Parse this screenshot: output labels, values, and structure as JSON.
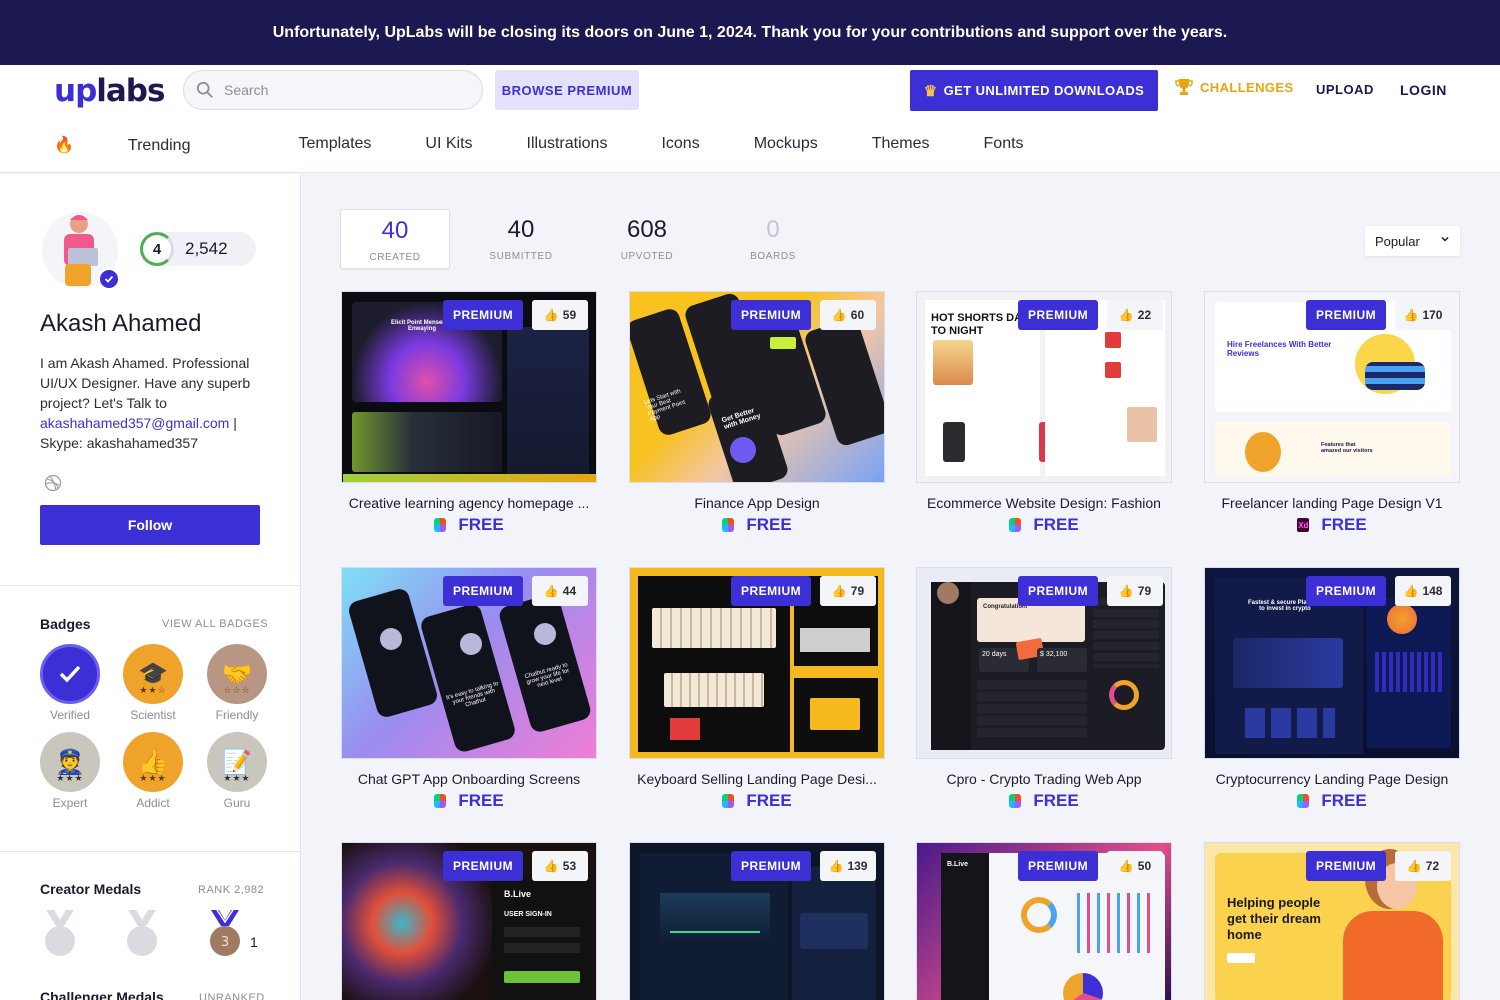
{
  "banner": {
    "text": "Unfortunately, UpLabs will be closing its doors on June 1, 2024. Thank you for your contributions and support over the years."
  },
  "header": {
    "logo_up": "up",
    "logo_labs": "labs",
    "search_placeholder": "Search",
    "browse_premium": "BROWSE PREMIUM",
    "unlimited": "GET UNLIMITED DOWNLOADS",
    "challenges": "CHALLENGES",
    "upload": "UPLOAD",
    "login": "LOGIN",
    "accent": "#3d2fd6"
  },
  "nav": {
    "items": [
      "Trending",
      "Templates",
      "UI Kits",
      "Illustrations",
      "Icons",
      "Mockups",
      "Themes",
      "Fonts"
    ]
  },
  "profile": {
    "level": "4",
    "points": "2,542",
    "name": "Akash Ahamed",
    "bio_1": "I am Akash Ahamed. Professional UI/UX Designer. Have any superb project? Let's Talk to ",
    "email": "akashahamed357@gmail.com",
    "bio_2": " | Skype: akashahamed357",
    "follow": "Follow"
  },
  "badges": {
    "title": "Badges",
    "view_all": "VIEW ALL BADGES",
    "items": [
      {
        "label": "Verified",
        "icon": "check-icon",
        "color": "#3d2fd6"
      },
      {
        "label": "Scientist",
        "icon": "graduation-cap-icon",
        "color": "#f0a32a"
      },
      {
        "label": "Friendly",
        "icon": "handshake-icon",
        "color": "#b99683"
      },
      {
        "label": "Expert",
        "icon": "officer-icon",
        "color": "#c9c7bd"
      },
      {
        "label": "Addict",
        "icon": "thumbs-up-icon",
        "color": "#f0a32a"
      },
      {
        "label": "Guru",
        "icon": "notepad-icon",
        "color": "#c9c7bd"
      }
    ]
  },
  "medals": {
    "title": "Creator Medals",
    "rank": "RANK 2,982",
    "bronze_count": "1",
    "bronze_number": "3"
  },
  "challenger": {
    "title": "Challenger Medals",
    "status": "UNRANKED"
  },
  "stats": [
    {
      "num": "40",
      "label": "CREATED"
    },
    {
      "num": "40",
      "label": "SUBMITTED"
    },
    {
      "num": "608",
      "label": "UPVOTED"
    },
    {
      "num": "0",
      "label": "BOARDS"
    }
  ],
  "sort": {
    "value": "Popular"
  },
  "cards": [
    {
      "title": "Creative learning agency homepage ...",
      "likes": "59",
      "price": "FREE",
      "tool": "figma",
      "premium": "PREMIUM"
    },
    {
      "title": "Finance App Design",
      "likes": "60",
      "price": "FREE",
      "tool": "figma",
      "premium": "PREMIUM"
    },
    {
      "title": "Ecommerce Website Design: Fashion",
      "likes": "22",
      "price": "FREE",
      "tool": "figma",
      "premium": "PREMIUM"
    },
    {
      "title": "Freelancer landing Page Design V1",
      "likes": "170",
      "price": "FREE",
      "tool": "xd",
      "premium": "PREMIUM"
    },
    {
      "title": "Chat GPT App Onboarding Screens",
      "likes": "44",
      "price": "FREE",
      "tool": "figma",
      "premium": "PREMIUM"
    },
    {
      "title": "Keyboard Selling Landing Page Desi...",
      "likes": "79",
      "price": "FREE",
      "tool": "figma",
      "premium": "PREMIUM"
    },
    {
      "title": "Cpro - Crypto Trading Web App",
      "likes": "79",
      "price": "FREE",
      "tool": "figma",
      "premium": "PREMIUM"
    },
    {
      "title": "Cryptocurrency Landing Page Design",
      "likes": "148",
      "price": "FREE",
      "tool": "figma",
      "premium": "PREMIUM"
    },
    {
      "title": "",
      "likes": "53",
      "price": "",
      "tool": "",
      "premium": "PREMIUM"
    },
    {
      "title": "",
      "likes": "139",
      "price": "",
      "tool": "",
      "premium": "PREMIUM"
    },
    {
      "title": "",
      "likes": "50",
      "price": "",
      "tool": "",
      "premium": "PREMIUM"
    },
    {
      "title": "",
      "likes": "72",
      "price": "",
      "tool": "",
      "premium": "PREMIUM"
    }
  ],
  "thumb_text": {
    "c1": "Elicit Point Mensen in Enwaying",
    "c2a": "Lets Start with Your Best Payment Point App",
    "c2b": "Get Better with Money",
    "c3": "HOT SHORTS DAY TO NIGHT",
    "c4": "Hire Freelances With Better Reviews",
    "c4b": "Features that amazed our visitors",
    "c5a": "It's easy to talking to your friends with Chathut",
    "c5b": "Chathut ready to grow your life for next level",
    "c7a": "Congratulation!",
    "c7b": "20 days",
    "c7c": "$ 32,100",
    "c8": "Fastest & secure Platform to invest in crypto",
    "c9": "USER SIGN-IN",
    "c9b": "B.Live",
    "c11": "B.Live",
    "c12": "Helping people get their dream home"
  }
}
